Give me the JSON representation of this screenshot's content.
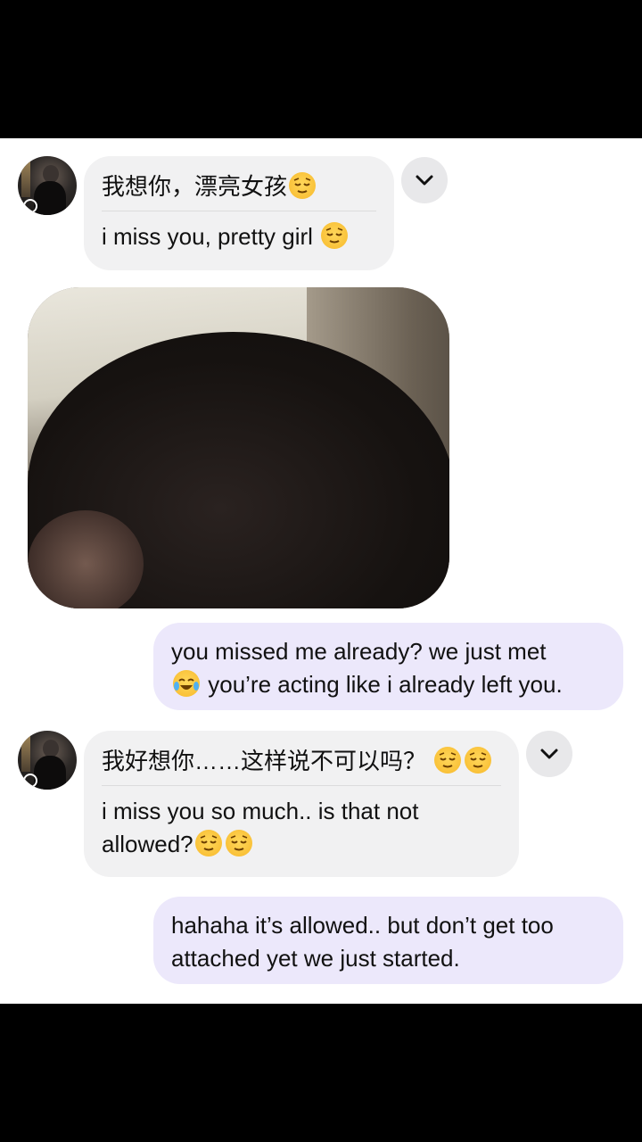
{
  "messages": [
    {
      "sender": "them",
      "original": "我想你，漂亮女孩",
      "translation": "i miss you, pretty girl",
      "emoji": [
        "relieved-face"
      ]
    },
    {
      "sender": "them",
      "type": "photo"
    },
    {
      "sender": "me",
      "line1": "you missed me already? we just met",
      "line2": "you’re acting like i already left you.",
      "emoji": [
        "tears-of-joy-face"
      ]
    },
    {
      "sender": "them",
      "original": "我好想你……这样说不可以吗？",
      "translation_line1": "i miss you so much.. is that not",
      "translation_line2": "allowed?",
      "emoji": [
        "relieved-face",
        "relieved-face"
      ]
    },
    {
      "sender": "me",
      "line1": "hahaha it’s allowed.. but don’t get too",
      "line2": "attached yet we just started."
    }
  ],
  "colors": {
    "incoming_bubble": "#f1f1f2",
    "outgoing_bubble": "#ece8fb",
    "background": "#ffffff",
    "letterbox": "#000000"
  }
}
